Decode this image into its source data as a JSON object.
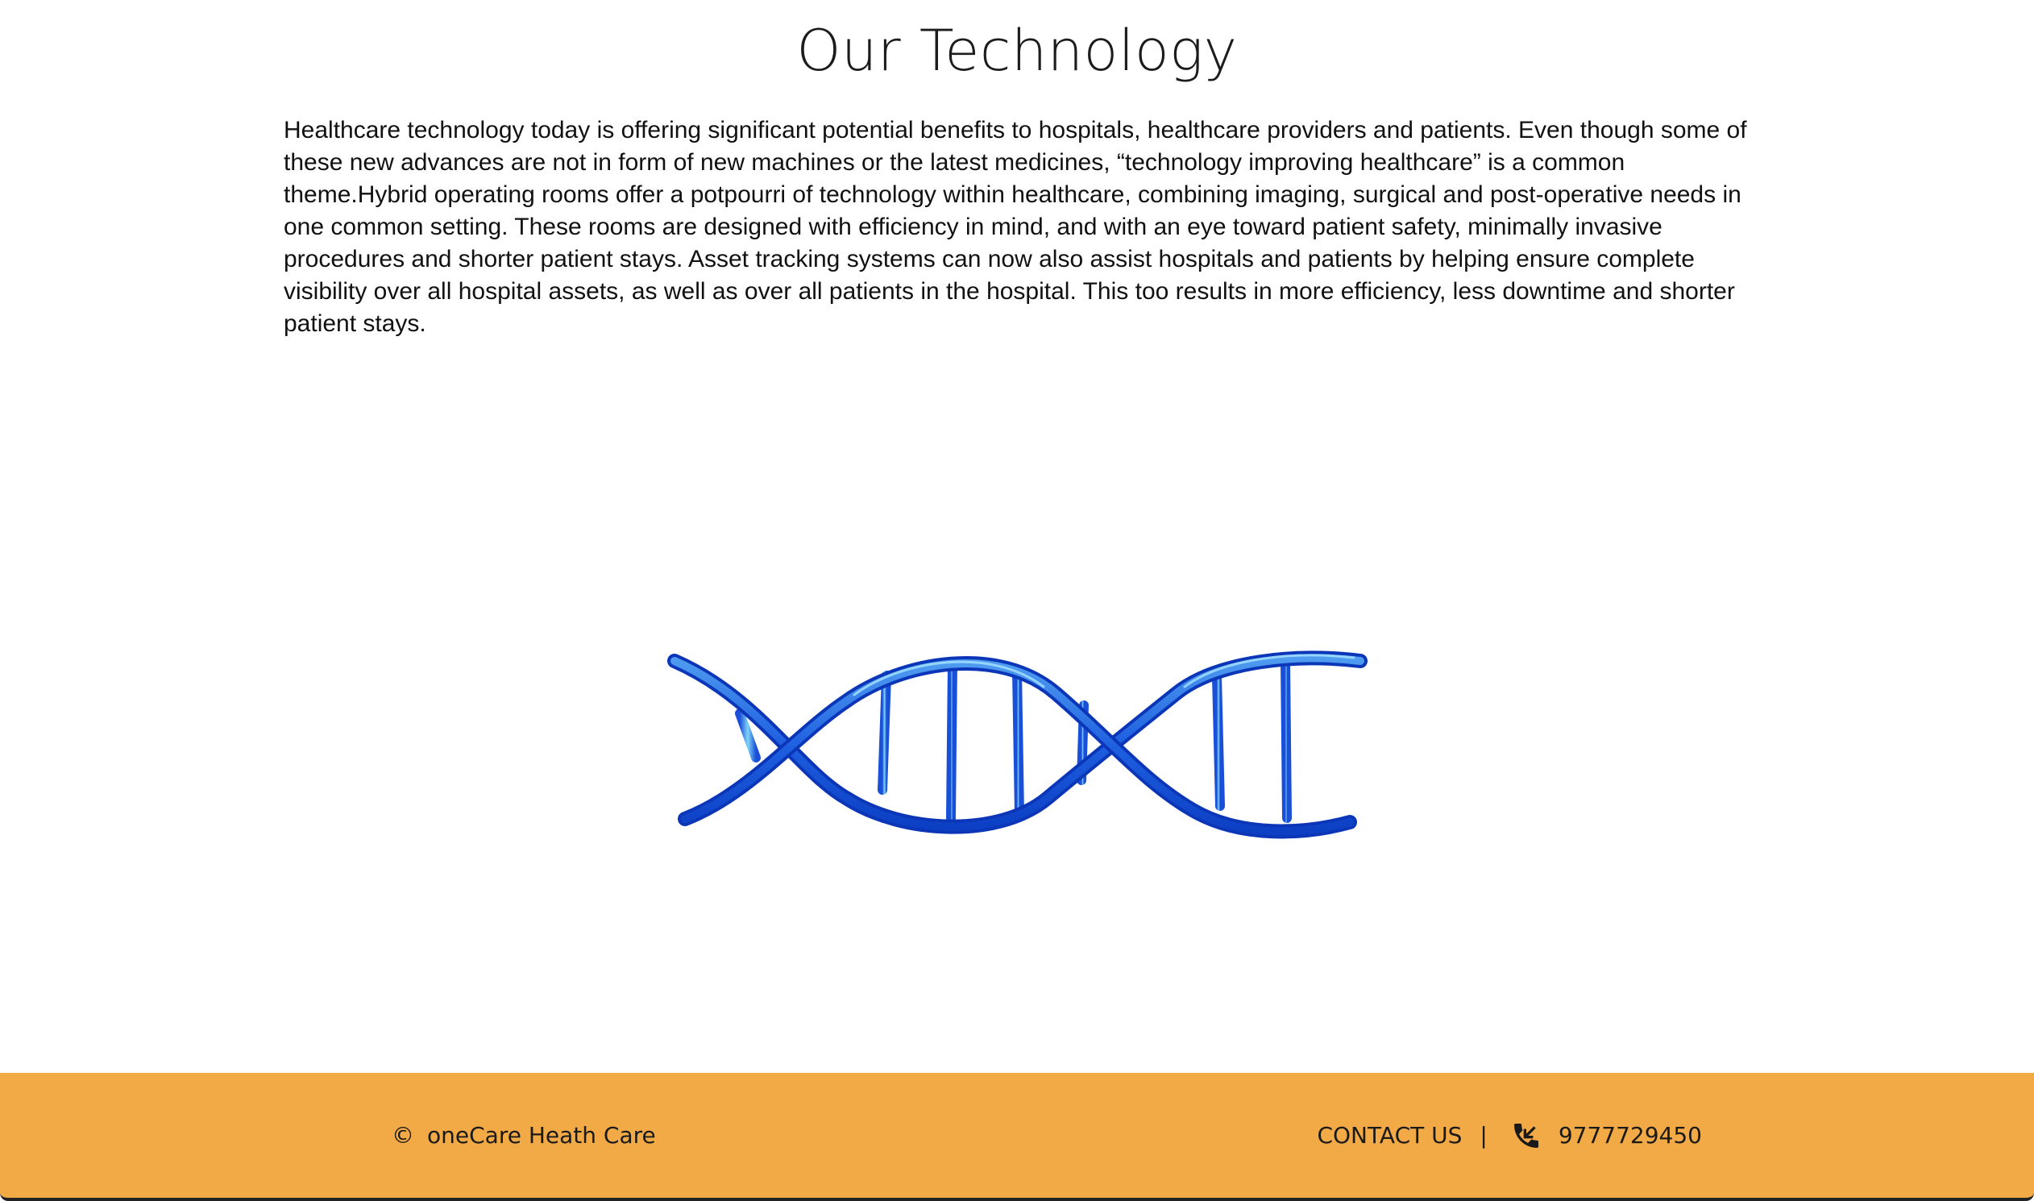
{
  "header": {
    "title": "Our Technology"
  },
  "content": {
    "paragraph": "Healthcare technology today is offering significant potential benefits to hospitals, healthcare providers and patients. Even though some of these new advances are not in form of new machines or the latest medicines, “technology improving healthcare” is a common theme.Hybrid operating rooms offer a potpourri of technology within healthcare, combining imaging, surgical and post-operative needs in one common setting. These rooms are designed with efficiency in mind, and with an eye toward patient safety, minimally invasive procedures and shorter patient stays. Asset tracking systems can now also assist hospitals and patients by helping ensure complete visibility over all hospital assets, as well as over all patients in the hospital. This too results in more efficiency, less downtime and shorter patient stays.",
    "image_icon": "dna-helix-image"
  },
  "footer": {
    "copyright_symbol": "©",
    "copyright_text": "oneCare Heath Care",
    "contact_label": "CONTACT US",
    "separator": "|",
    "phone_icon": "phone-incoming-icon",
    "phone_number": "9777729450",
    "background_color": "#f2aa47"
  }
}
